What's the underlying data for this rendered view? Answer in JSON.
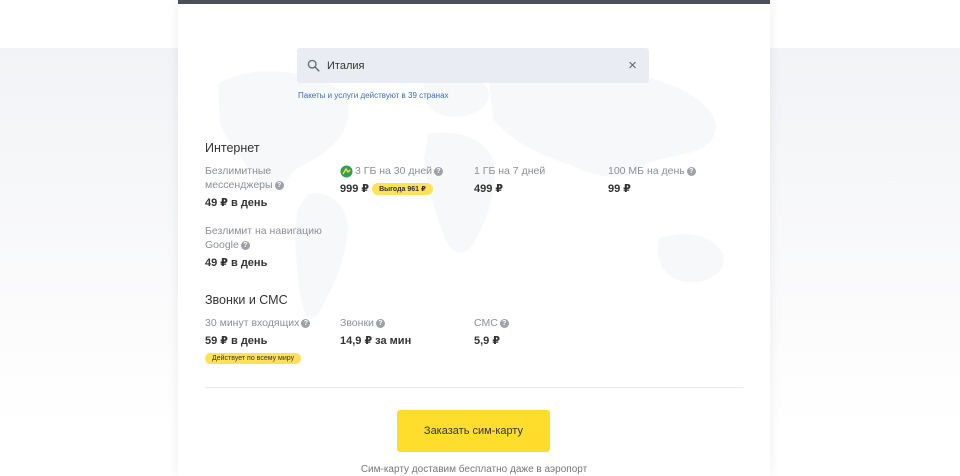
{
  "search": {
    "value": "Италия",
    "hint": "Пакеты и услуги действуют в 39 странах"
  },
  "internet": {
    "title": "Интернет",
    "options": [
      {
        "label": "Безлимитные мессенджеры",
        "price": "49 ₽ в день"
      },
      {
        "label": "3 ГБ на 30 дней",
        "price": "999 ₽",
        "badge": "Выгода 961 ₽"
      },
      {
        "label": "1 ГБ на 7 дней",
        "price": "499 ₽"
      },
      {
        "label": "100 МБ на день",
        "price": "99 ₽"
      },
      {
        "label": "Безлимит на навигацию Google",
        "price": "49 ₽ в день"
      }
    ]
  },
  "calls": {
    "title": "Звонки и СМС",
    "options": [
      {
        "label": "30 минут входящих",
        "price": "59 ₽ в день",
        "badge": "Действует по всему миру"
      },
      {
        "label": "Звонки",
        "price": "14,9 ₽ за мин"
      },
      {
        "label": "СМС",
        "price": "5,9 ₽"
      }
    ]
  },
  "help_glyph": "?",
  "close_glyph": "×",
  "order_button": "Заказать сим-карту",
  "footnote": "Сим-карту доставим бесплатно даже в аэропорт",
  "colors": {
    "accent": "#ffdd2d",
    "badge": "#ffe15a",
    "link": "#3b6fb8",
    "top_bar": "#4a4f58"
  }
}
